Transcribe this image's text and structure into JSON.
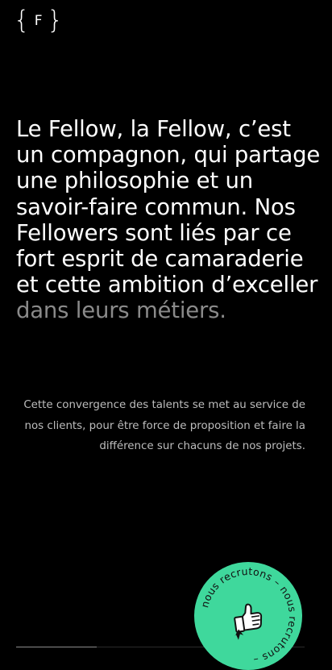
{
  "logo": {
    "open": "{",
    "letter": "F",
    "close": "}"
  },
  "intro": {
    "headline_main": "Le Fellow, la Fellow, c’est un compagnon, qui partage une philosophie et un savoir-faire commun. Nos Fellowers sont liés par ce fort esprit de camaraderie et cette ambition d’exceller",
    "headline_muted": "dans leurs métiers.",
    "lead": "Cette convergence des talents se met au service de nos clients, pour être force de proposition et faire la différence sur chacuns de nos projets."
  },
  "recruit_badge": {
    "text": "nous recrutons – nous recrutons – ",
    "icon": "thumbs-up-hand-icon",
    "color": "#3fd89c"
  },
  "scroll_progress": 0.28,
  "colors": {
    "background": "#000000",
    "text": "#ffffff",
    "muted": "#8a8a8a",
    "accent": "#3fd89c"
  }
}
